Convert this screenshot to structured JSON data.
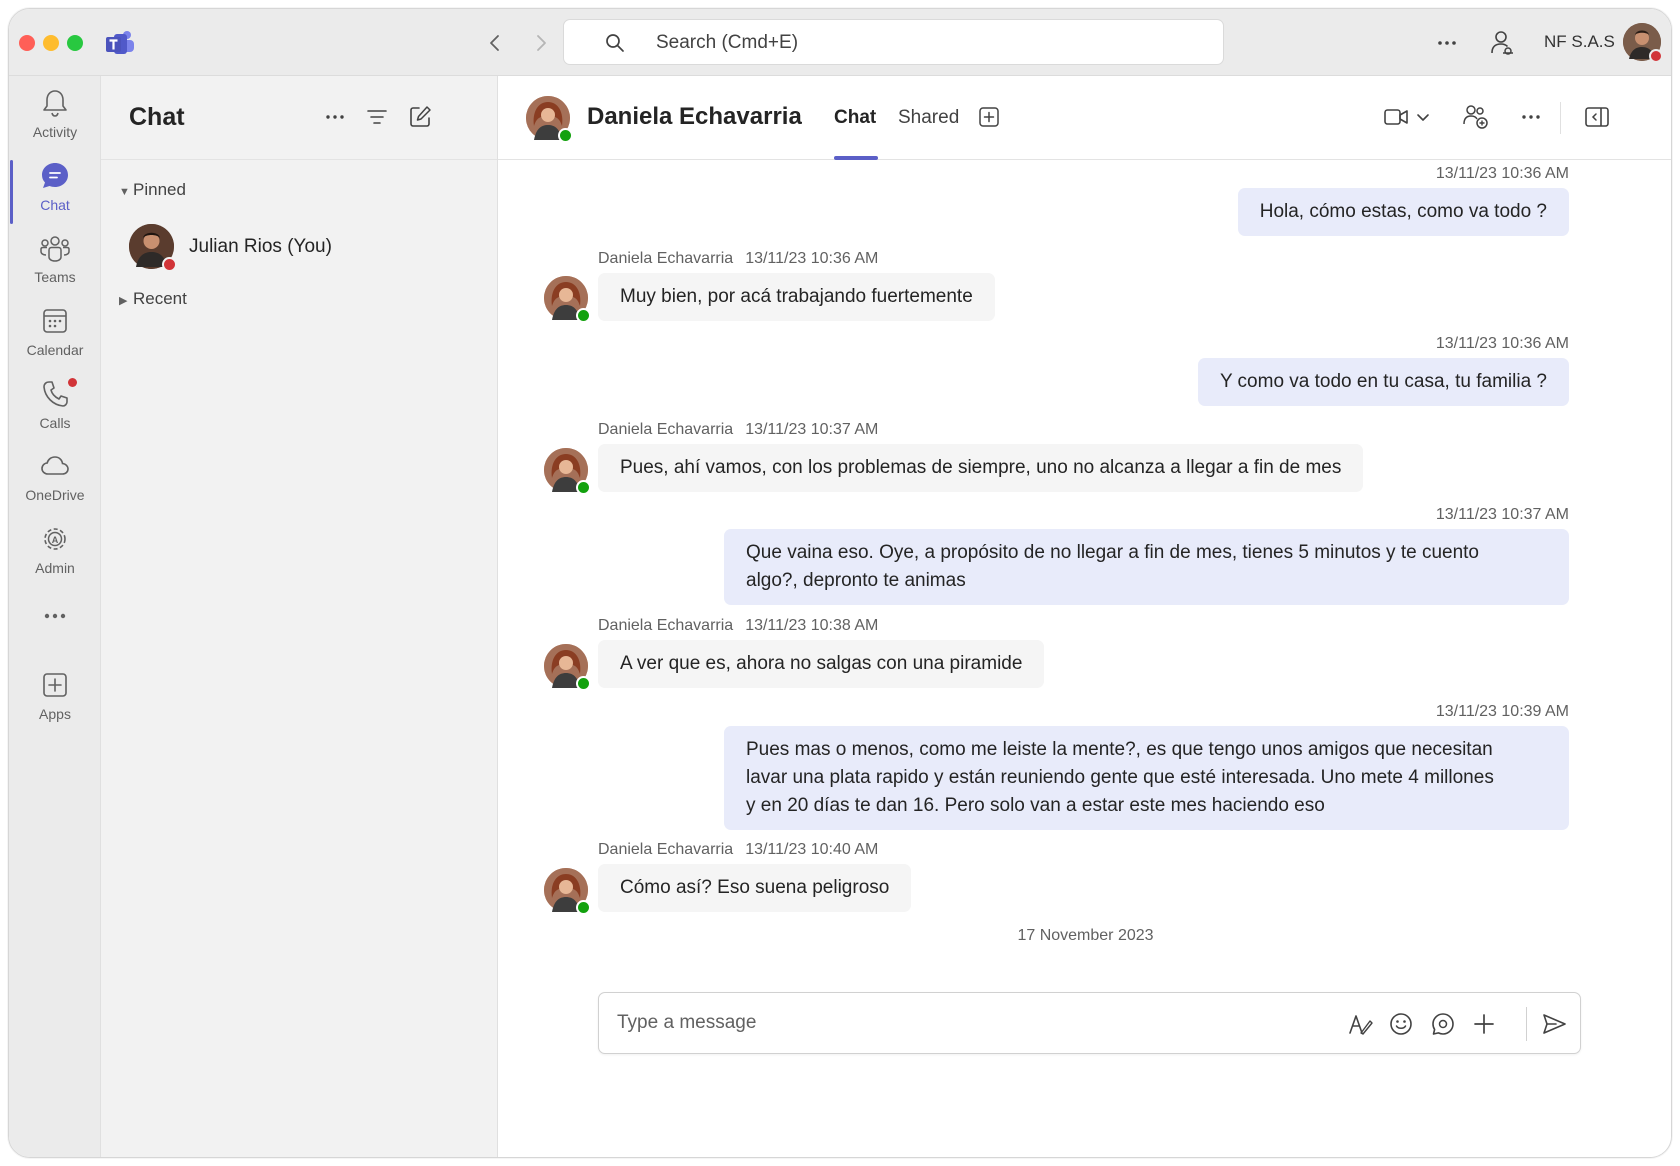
{
  "titlebar": {
    "search_placeholder": "Search (Cmd+E)",
    "org_name": "NF S.A.S"
  },
  "rail": {
    "items": [
      {
        "label": "Activity",
        "icon": "bell-icon"
      },
      {
        "label": "Chat",
        "icon": "chat-icon"
      },
      {
        "label": "Teams",
        "icon": "teams-icon"
      },
      {
        "label": "Calendar",
        "icon": "calendar-icon"
      },
      {
        "label": "Calls",
        "icon": "phone-icon"
      },
      {
        "label": "OneDrive",
        "icon": "cloud-icon"
      },
      {
        "label": "Admin",
        "icon": "admin-gear-icon"
      },
      {
        "label": "",
        "icon": "more-horizontal-icon"
      },
      {
        "label": "Apps",
        "icon": "add-app-icon"
      }
    ],
    "active": "Chat"
  },
  "chatlist": {
    "title": "Chat",
    "pinned_label": "Pinned",
    "recent_label": "Recent",
    "pinned": [
      {
        "name": "Julian Rios (You)",
        "status": "busy"
      }
    ]
  },
  "conversation": {
    "contact_name": "Daniela Echavarria",
    "tabs": [
      "Chat",
      "Shared"
    ],
    "active_tab": "Chat",
    "messages": [
      {
        "direction": "out",
        "time": "13/11/23 10:36 AM",
        "lines": [
          "Hola, cómo estas, como va todo ?"
        ]
      },
      {
        "direction": "in",
        "sender": "Daniela Echavarria",
        "time": "13/11/23 10:36 AM",
        "lines": [
          "Muy bien, por acá trabajando fuertemente"
        ]
      },
      {
        "direction": "out",
        "time": "13/11/23 10:36 AM",
        "lines": [
          "Y como va todo en tu casa, tu familia ?"
        ]
      },
      {
        "direction": "in",
        "sender": "Daniela Echavarria",
        "time": "13/11/23 10:37 AM",
        "lines": [
          "Pues, ahí vamos, con los problemas de siempre, uno no alcanza a llegar a fin de mes"
        ]
      },
      {
        "direction": "out",
        "time": "13/11/23 10:37 AM",
        "lines": [
          "Que vaina eso. Oye, a propósito de no llegar a fin de mes, tienes 5 minutos y te cuento",
          "algo?, depronto te animas"
        ]
      },
      {
        "direction": "in",
        "sender": "Daniela Echavarria",
        "time": "13/11/23 10:38 AM",
        "lines": [
          "A ver que es, ahora no salgas con una piramide"
        ]
      },
      {
        "direction": "out",
        "time": "13/11/23 10:39 AM",
        "lines": [
          "Pues mas o menos, como me leiste la mente?, es que tengo unos amigos que necesitan",
          "lavar una plata rapido y están reuniendo gente que esté interesada. Uno mete 4 millones",
          "y en 20 días te dan 16. Pero solo van a estar este mes haciendo eso"
        ]
      },
      {
        "direction": "in",
        "sender": "Daniela Echavarria",
        "time": "13/11/23 10:40 AM",
        "lines": [
          "Cómo así? Eso suena peligroso"
        ]
      }
    ],
    "date_separator": "17 November 2023",
    "composer_placeholder": "Type a message"
  },
  "colors": {
    "accent": "#5b5fc7",
    "outgoing_bubble": "#e8ebfa",
    "incoming_bubble": "#f5f5f5",
    "available": "#13a10e",
    "busy": "#d13438"
  }
}
